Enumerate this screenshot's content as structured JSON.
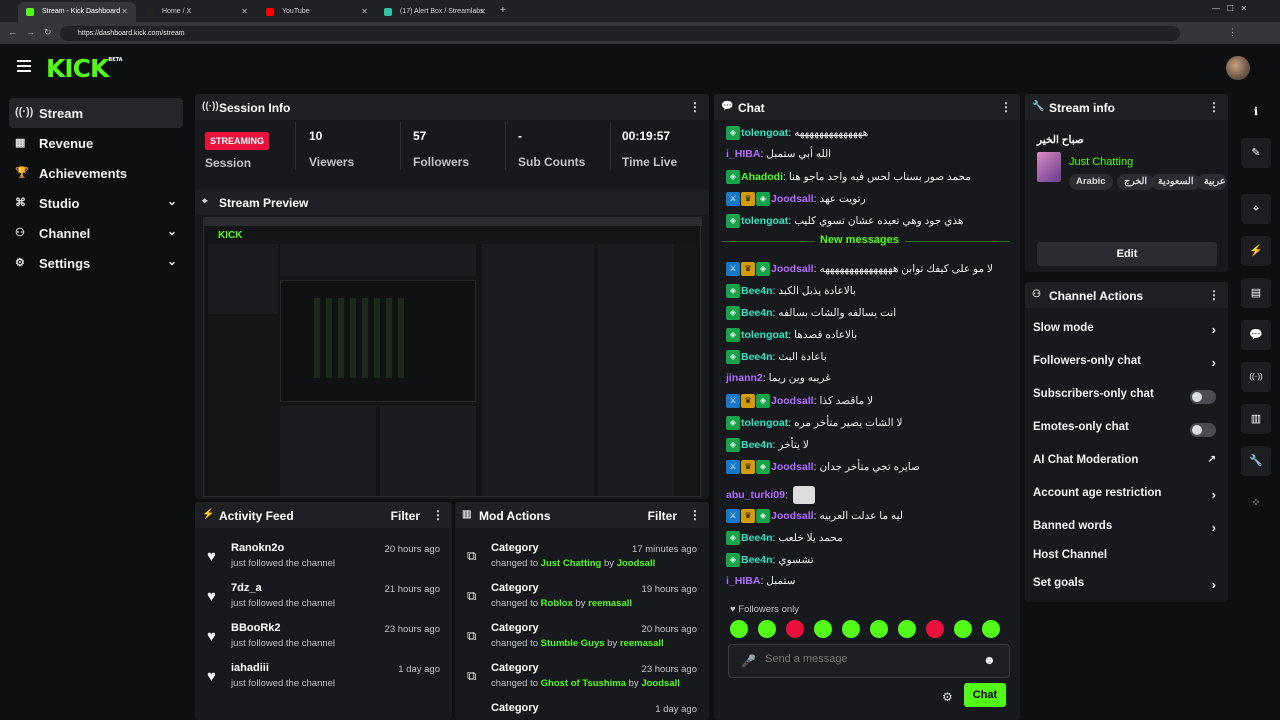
{
  "browser": {
    "tabs": [
      {
        "title": "Stream - Kick Dashboard",
        "color": "#53fc18"
      },
      {
        "title": "Home / X",
        "color": "#222222"
      },
      {
        "title": "YouTube",
        "color": "#ff0000"
      },
      {
        "title": "(17) Alert Box / Streamlabs",
        "color": "#31c3a2"
      }
    ],
    "url": "https://dashboard.kick.com/stream"
  },
  "brand": {
    "logo": "KICK",
    "beta": "BETA",
    "accent": "#53fc18"
  },
  "sidebar": {
    "items": [
      {
        "label": "Stream",
        "icon": "broadcast-icon",
        "glyph": "((·))",
        "active": true
      },
      {
        "label": "Revenue",
        "icon": "revenue-icon",
        "glyph": "▦"
      },
      {
        "label": "Achievements",
        "icon": "trophy-icon",
        "glyph": "🏆"
      },
      {
        "label": "Studio",
        "icon": "studio-icon",
        "glyph": "⌘",
        "expandable": true
      },
      {
        "label": "Channel",
        "icon": "channel-icon",
        "glyph": "⚇",
        "expandable": true
      },
      {
        "label": "Settings",
        "icon": "gear-icon",
        "glyph": "⚙",
        "expandable": true
      }
    ]
  },
  "session": {
    "title": "Session Info",
    "status": "STREAMING",
    "status_label": "Session",
    "stats": [
      {
        "value": "10",
        "label": "Viewers"
      },
      {
        "value": "57",
        "label": "Followers"
      },
      {
        "value": "-",
        "label": "Sub Counts"
      },
      {
        "value": "00:19:57",
        "label": "Time Live"
      }
    ]
  },
  "preview": {
    "title": "Stream Preview"
  },
  "activity": {
    "title": "Activity Feed",
    "filter": "Filter",
    "items": [
      {
        "name": "Ranokn2o",
        "action": "just followed the channel",
        "time": "20 hours ago"
      },
      {
        "name": "7dz_a",
        "action": "just followed the channel",
        "time": "21 hours ago"
      },
      {
        "name": "BBooRk2",
        "action": "just followed the channel",
        "time": "23 hours ago"
      },
      {
        "name": "iahadiii",
        "action": "just followed the channel",
        "time": "1 day ago"
      }
    ]
  },
  "mod": {
    "title": "Mod Actions",
    "filter": "Filter",
    "items": [
      {
        "type": "Category",
        "prefix": "changed to",
        "target": "Just Chatting",
        "by": "by",
        "user": "Joodsall",
        "time": "17 minutes ago"
      },
      {
        "type": "Category",
        "prefix": "changed to",
        "target": "Roblox",
        "by": "by",
        "user": "reemasall",
        "time": "19 hours ago"
      },
      {
        "type": "Category",
        "prefix": "changed to",
        "target": "Stumble Guys",
        "by": "by",
        "user": "reemasall",
        "time": "20 hours ago"
      },
      {
        "type": "Category",
        "prefix": "changed to",
        "target": "Ghost of Tsushima",
        "by": "by",
        "user": "Joodsall",
        "time": "23 hours ago"
      },
      {
        "type": "Category",
        "time": "1 day ago"
      }
    ]
  },
  "chat": {
    "title": "Chat",
    "new_messages": "New messages",
    "followers_only": "Followers only",
    "placeholder": "Send a message",
    "send_label": "Chat",
    "messages": [
      {
        "user": "tolengoat",
        "color": "#2ee6c4",
        "badges": [
          "green"
        ],
        "text": "ههههههههههههههه"
      },
      {
        "user": "i_HIBA",
        "color": "#b06bff",
        "badges": [],
        "text": "الله أبي ستمبل"
      },
      {
        "user": "Ahadodi",
        "color": "#53fc18",
        "badges": [
          "green"
        ],
        "text": "محمد صور بسناب لحس فيه واجد ماجو هنا"
      },
      {
        "user": "Joodsall",
        "color": "#b06bff",
        "badges": [
          "blue",
          "gold",
          "green"
        ],
        "text": "رتويت عهد"
      },
      {
        "user": "tolengoat",
        "color": "#2ee6c4",
        "badges": [
          "green"
        ],
        "text": "هذي جود وهي تعيده عشان تسوي كليب"
      },
      {
        "user": "Joodsall",
        "color": "#b06bff",
        "badges": [
          "blue",
          "gold",
          "green"
        ],
        "text": "لا مو على كيفك توابن هههههههههههههههه"
      },
      {
        "user": "Bee4n",
        "color": "#2ee6c4",
        "badges": [
          "green"
        ],
        "text": "بالاعادة يذبل الكبد"
      },
      {
        "user": "Bee4n",
        "color": "#2ee6c4",
        "badges": [
          "green"
        ],
        "text": "انت يسالفه والشات بسالفه"
      },
      {
        "user": "tolengoat",
        "color": "#2ee6c4",
        "badges": [
          "green"
        ],
        "text": "بالاعاده قصدها"
      },
      {
        "user": "Bee4n",
        "color": "#2ee6c4",
        "badges": [
          "green"
        ],
        "text": "باعادة البث"
      },
      {
        "user": "jinann2",
        "color": "#b06bff",
        "badges": [],
        "text": "غريبه وين ريما"
      },
      {
        "user": "Joodsall",
        "color": "#b06bff",
        "badges": [
          "blue",
          "gold",
          "green"
        ],
        "text": "لا ماقصد كذا"
      },
      {
        "user": "tolengoat",
        "color": "#2ee6c4",
        "badges": [
          "green"
        ],
        "text": "لا الشات يصير متأخر مره"
      },
      {
        "user": "Bee4n",
        "color": "#2ee6c4",
        "badges": [
          "green"
        ],
        "text": "لا يتأخر"
      },
      {
        "user": "Joodsall",
        "color": "#b06bff",
        "badges": [
          "blue",
          "gold",
          "green"
        ],
        "text": "صايره تجي متأخر جدان"
      },
      {
        "user": "abu_turki09",
        "color": "#b06bff",
        "badges": [],
        "text": ""
      },
      {
        "user": "Joodsall",
        "color": "#b06bff",
        "badges": [
          "blue",
          "gold",
          "green"
        ],
        "text": "ليه ما عدلت العربيه"
      },
      {
        "user": "Bee4n",
        "color": "#2ee6c4",
        "badges": [
          "green"
        ],
        "text": "محمد يلا خلعب"
      },
      {
        "user": "Bee4n",
        "color": "#2ee6c4",
        "badges": [
          "green"
        ],
        "text": "تشسوي"
      },
      {
        "user": "i_HIBA",
        "color": "#b06bff",
        "badges": [],
        "text": "ستمبل"
      }
    ]
  },
  "stream_info": {
    "title": "Stream info",
    "stream_title": "صباح الخير",
    "category": "Just Chatting",
    "tags": [
      "Arabic",
      "الخرج",
      "السعودية",
      "عربية"
    ],
    "edit_label": "Edit"
  },
  "actions": {
    "title": "Channel Actions",
    "items": [
      {
        "label": "Slow mode",
        "control": "chevron"
      },
      {
        "label": "Followers-only chat",
        "control": "chevron"
      },
      {
        "label": "Subscribers-only chat",
        "control": "toggle"
      },
      {
        "label": "Emotes-only chat",
        "control": "toggle"
      },
      {
        "label": "AI Chat Moderation",
        "control": "external"
      },
      {
        "label": "Account age restriction",
        "control": "chevron"
      },
      {
        "label": "Banned words",
        "control": "chevron"
      },
      {
        "label": "Host Channel",
        "control": "none"
      },
      {
        "label": "Set goals",
        "control": "chevron"
      }
    ]
  },
  "rail": [
    {
      "icon": "info-icon",
      "glyph": "ℹ"
    },
    {
      "icon": "pencil-icon",
      "glyph": "✎"
    },
    {
      "icon": "focus-icon",
      "glyph": "⌖"
    },
    {
      "icon": "lightning-icon",
      "glyph": "⚡"
    },
    {
      "icon": "notes-icon",
      "glyph": "▤"
    },
    {
      "icon": "chat-bubble-icon",
      "glyph": "💬"
    },
    {
      "icon": "broadcast-icon",
      "glyph": "((·))"
    },
    {
      "icon": "layout-icon",
      "glyph": "▥"
    },
    {
      "icon": "wrench-icon",
      "glyph": "🔧"
    },
    {
      "icon": "apps-icon",
      "glyph": "⁘"
    }
  ]
}
